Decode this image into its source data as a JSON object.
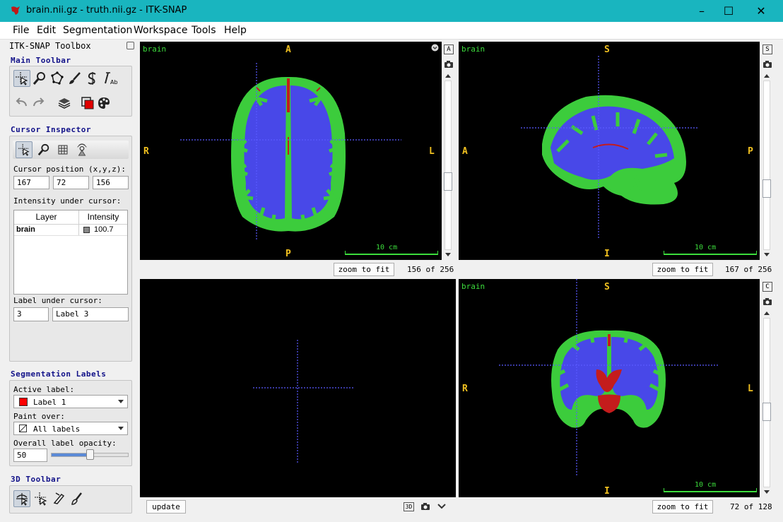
{
  "window": {
    "title": "brain.nii.gz - truth.nii.gz - ITK-SNAP",
    "minimize_glyph": "–",
    "maximize_glyph": "☐",
    "close_glyph": "✕"
  },
  "menu": [
    {
      "label": "File"
    },
    {
      "label": "Edit"
    },
    {
      "label": "Segmentation"
    },
    {
      "label": "Workspace"
    },
    {
      "label": "Tools"
    },
    {
      "label": "Help"
    }
  ],
  "toolbox": {
    "title": "ITK-SNAP Toolbox",
    "main_toolbar": {
      "title": "Main Toolbar",
      "tools": [
        "crosshair-tool-icon",
        "zoom-tool-icon",
        "polygon-tool-icon",
        "paintbrush-tool-icon",
        "snake-tool-icon",
        "annotation-tool-icon"
      ],
      "actions": [
        "undo-icon",
        "redo-icon",
        "layers-icon",
        "label-color-icon",
        "palette-icon"
      ]
    },
    "cursor_inspector": {
      "title": "Cursor Inspector",
      "position_label": "Cursor position (x,y,z):",
      "x": "167",
      "y": "72",
      "z": "156",
      "intensity_label": "Intensity under cursor:",
      "table_headers": [
        "Layer",
        "Intensity"
      ],
      "rows": [
        {
          "layer": "brain",
          "intensity": "100.7"
        }
      ],
      "label_under_cursor_label": "Label under cursor:",
      "label_id": "3",
      "label_name": "Label 3"
    },
    "segmentation_labels": {
      "title": "Segmentation Labels",
      "active_label_caption": "Active label:",
      "active_label": "Label 1",
      "active_label_color": "#ff0000",
      "paint_over_caption": "Paint over:",
      "paint_over": "All labels",
      "opacity_caption": "Overall label opacity:",
      "opacity_value": "50",
      "opacity_fraction": 0.5
    },
    "toolbar_3d": {
      "title": "3D Toolbar",
      "tools": [
        "3d-rotate-icon",
        "3d-crosshair-icon",
        "3d-scalpel-icon",
        "3d-spray-icon"
      ]
    }
  },
  "views": {
    "axial": {
      "layer": "brain",
      "top": "A",
      "bottom": "P",
      "left": "R",
      "right": "L",
      "scale": "10 cm",
      "side_button": "A",
      "zoom_button": "zoom to fit",
      "slice": "156 of 256"
    },
    "sagittal": {
      "layer": "brain",
      "top": "S",
      "bottom": "I",
      "left": "A",
      "right": "P",
      "scale": "10 cm",
      "side_button": "S",
      "zoom_button": "zoom to fit",
      "slice": "167 of 256"
    },
    "render3d": {
      "update_button": "update",
      "button_3d": "3D"
    },
    "coronal": {
      "layer": "brain",
      "top": "S",
      "bottom": "I",
      "left": "R",
      "right": "L",
      "scale": "10 cm",
      "side_button": "C",
      "zoom_button": "zoom to fit",
      "slice": "72 of 128"
    }
  },
  "colors": {
    "titlebar": "#19b5bf",
    "gray_matter": "#3ccc3c",
    "white_matter": "#4848e8",
    "ventricles": "#c41c1c",
    "orientation_text": "#f0c020",
    "crosshair": "#5a5aff"
  }
}
